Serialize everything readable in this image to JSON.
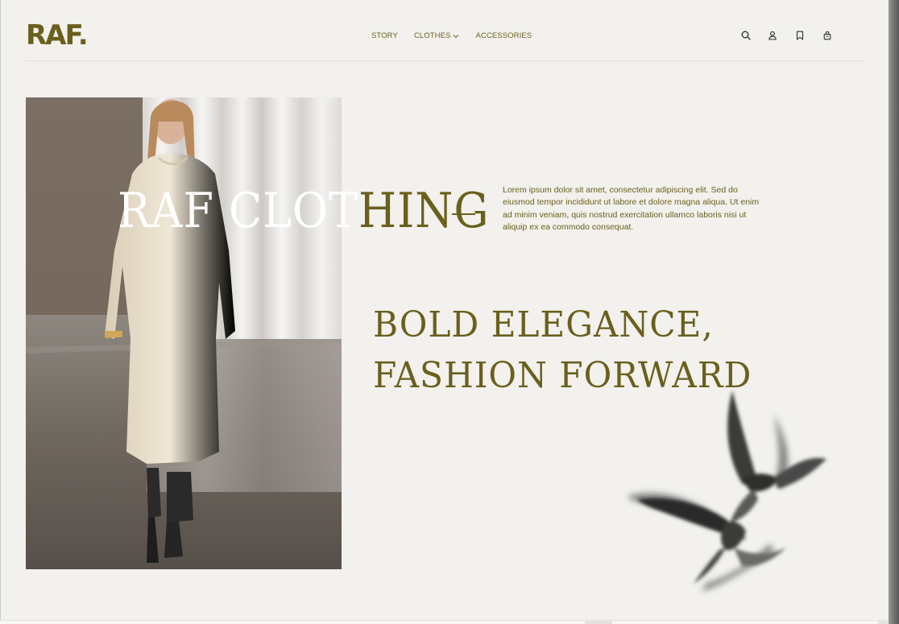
{
  "brand": {
    "logo_text": "RAF."
  },
  "nav": {
    "items": [
      {
        "label": "STORY"
      },
      {
        "label": "CLOTHES"
      },
      {
        "label": "ACCESSORIES"
      }
    ]
  },
  "header_icons": [
    "search-icon",
    "user-icon",
    "bookmark-icon",
    "bag-icon"
  ],
  "hero": {
    "title_white": "RAF CLOT",
    "title_olive": "HING",
    "description": "Lorem ipsum dolor sit amet, consectetur adipiscing elit. Sed do eiusmod tempor incididunt ut labore et dolore magna aliqua. Ut enim ad minim veniam, quis nostrud exercitation ullamco laboris nisi ut aliquip ex ea commodo consequat.",
    "tagline_line1": "BOLD ELEGANCE,",
    "tagline_line2": "FASHION FORWARD"
  },
  "colors": {
    "accent_olive": "#6a5f1c",
    "background": "#f2f1ed",
    "text_white": "#ffffff"
  }
}
